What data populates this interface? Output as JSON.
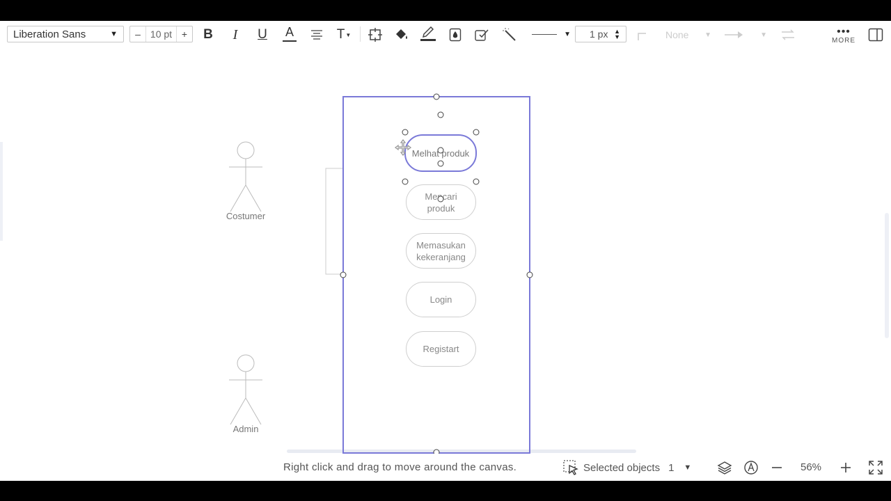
{
  "toolbar": {
    "font_family": "Liberation Sans",
    "font_size": "10 pt",
    "size_minus": "–",
    "size_plus": "+",
    "bold": "B",
    "italic": "I",
    "underline": "U",
    "font_color": "A",
    "text_type": "T",
    "line_width": "1 px",
    "arrow_start": "None",
    "more_label": "MORE"
  },
  "diagram": {
    "actors": [
      {
        "label": "Costumer"
      },
      {
        "label": "Admin"
      }
    ],
    "usecases": [
      {
        "label": "Melhat produk"
      },
      {
        "label": "Mencari\nproduk"
      },
      {
        "label": "Memasukan\nkekeranjang"
      },
      {
        "label": "Login"
      },
      {
        "label": "Registart"
      }
    ]
  },
  "statusbar": {
    "hint": "Right click and drag to move around the canvas.",
    "selected_label": "Selected objects",
    "selected_count": "1",
    "zoom": "56%"
  },
  "colors": {
    "selection": "#7a79d8",
    "handle": "#444444",
    "text_muted": "#888888"
  }
}
